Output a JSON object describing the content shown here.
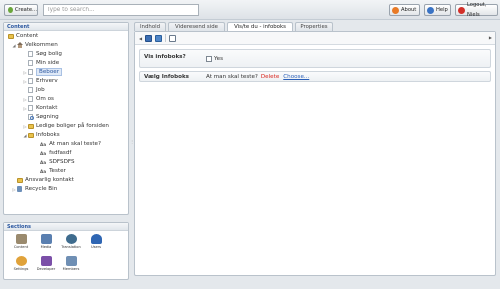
{
  "topbar": {
    "create_label": "Create...",
    "search_placeholder": "Type to search...",
    "about_label": "About",
    "help_label": "Help",
    "logout_label": "Logout, Niels"
  },
  "content_panel": {
    "title": "Content",
    "tree": [
      {
        "label": "Content"
      },
      {
        "label": "Velkommen"
      },
      {
        "label": "Søg bolig"
      },
      {
        "label": "Min side"
      },
      {
        "label": "Beboer"
      },
      {
        "label": "Erhverv"
      },
      {
        "label": "Job"
      },
      {
        "label": "Om os"
      },
      {
        "label": "Kontakt"
      },
      {
        "label": "Søgning"
      },
      {
        "label": "Ledige boliger på forsiden"
      },
      {
        "label": "Infoboks"
      },
      {
        "label": "At man skal teste?"
      },
      {
        "label": "fsdfasdf"
      },
      {
        "label": "SDFSDFS"
      },
      {
        "label": "Tester"
      },
      {
        "label": "Ansvarlig kontakt"
      },
      {
        "label": "Recycle Bin"
      }
    ]
  },
  "sections": {
    "title": "Sections",
    "items": [
      {
        "label": "Content",
        "color": "#9a8a6e"
      },
      {
        "label": "Media",
        "color": "#5a7fb0"
      },
      {
        "label": "Translation",
        "color": "#3f6c8e"
      },
      {
        "label": "Users",
        "color": "#2f66b3"
      },
      {
        "label": "Settings",
        "color": "#e0a23a"
      },
      {
        "label": "Developer",
        "color": "#7b4fa8"
      },
      {
        "label": "Members",
        "color": "#6f8fb4"
      }
    ]
  },
  "tabs": [
    {
      "label": "Indhold"
    },
    {
      "label": "Videresend side"
    },
    {
      "label": "Vis/te du - infoboks"
    },
    {
      "label": "Properties"
    }
  ],
  "properties": {
    "show_infobox_label": "Vis infoboks?",
    "show_infobox_value": "Yes",
    "choose_infobox_label": "Vælg Infoboks",
    "choose_infobox_value": "At man skal teste?",
    "delete_label": "Delete",
    "choose_label": "Choose..."
  }
}
